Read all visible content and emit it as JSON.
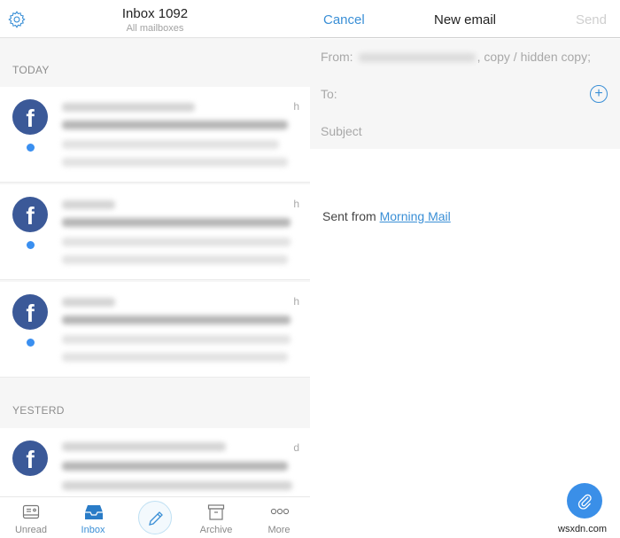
{
  "inbox": {
    "title": "Inbox 1092",
    "subtitle": "All mailboxes",
    "sections": {
      "today": "TODAY",
      "yesterday": "YESTERD"
    },
    "messages": [
      {
        "sender_icon": "facebook-icon",
        "unread": true,
        "time": "h"
      },
      {
        "sender_icon": "facebook-icon",
        "unread": true,
        "time": "h"
      },
      {
        "sender_icon": "facebook-icon",
        "unread": true,
        "time": "h"
      },
      {
        "sender_icon": "facebook-icon",
        "unread": false,
        "time": "d"
      }
    ],
    "tabbar": {
      "unread": "Unread",
      "inbox": "Inbox",
      "archive": "Archive",
      "more": "More"
    }
  },
  "compose": {
    "cancel": "Cancel",
    "title": "New email",
    "send": "Send",
    "from_label": "From:",
    "from_suffix": ", copy / hidden copy;",
    "to_label": "To:",
    "subject_placeholder": "Subject",
    "signature_prefix": "Sent from ",
    "signature_link": "Morning Mail"
  },
  "watermark": "wsxdn.com",
  "colors": {
    "accent": "#3a8fd6",
    "facebook": "#3b5998",
    "unread_dot": "#3a8ff0",
    "fab": "#3a8fe8"
  }
}
